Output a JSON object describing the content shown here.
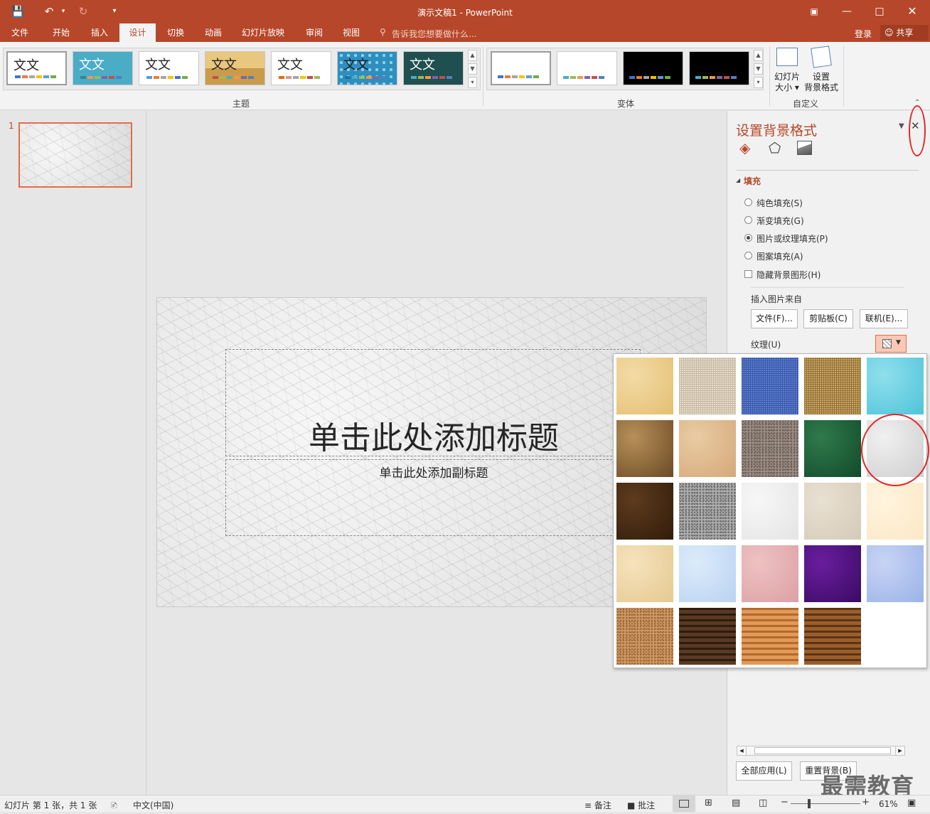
{
  "window": {
    "title": "演示文稿1 - PowerPoint"
  },
  "ribbon_tabs": [
    "文件",
    "开始",
    "插入",
    "设计",
    "切换",
    "动画",
    "幻灯片放映",
    "审阅",
    "视图"
  ],
  "active_tab": "设计",
  "tell_me": "告诉我您想要做什么...",
  "account": {
    "login": "登录",
    "share": "共享"
  },
  "themes": {
    "label": "主题",
    "items": [
      {
        "text": "文文",
        "bg": "#ffffff",
        "fg": "#222222",
        "colors": [
          "#4472c4",
          "#ed7d31",
          "#a5a5a5",
          "#ffc000",
          "#5b9bd5",
          "#70ad47"
        ]
      },
      {
        "text": "文文",
        "bg": "#4bacc6",
        "fg": "#ffffff",
        "colors": [
          "#31859c",
          "#f79646",
          "#9bbb59",
          "#8064a2",
          "#c0504d",
          "#4f81bd"
        ]
      },
      {
        "text": "文文",
        "bg": "#ffffff",
        "fg": "#222222",
        "colors": [
          "#5b9bd5",
          "#ed7d31",
          "#a5a5a5",
          "#ffc000",
          "#4472c4",
          "#70ad47"
        ]
      },
      {
        "text": "文文",
        "bg": "#e9c77f",
        "fg": "#222222",
        "colors": [
          "#c0504d",
          "#9bbb59",
          "#4bacc6",
          "#f79646",
          "#8064a2",
          "#4f81bd"
        ]
      },
      {
        "text": "文文",
        "bg": "#ffffff",
        "fg": "#222222",
        "colors": [
          "#e46c0a",
          "#d99694",
          "#a5a5a5",
          "#ffc000",
          "#c0504d",
          "#9bbb59"
        ]
      },
      {
        "text": "文文",
        "bg": "#2e8fbf",
        "fg": "#222222",
        "colors": [
          "#1f6f9f",
          "#4bacc6",
          "#9bbb59",
          "#f79646",
          "#8064a2",
          "#4f81bd"
        ]
      },
      {
        "text": "文文",
        "bg": "#1f4f4f",
        "fg": "#ffffff",
        "colors": [
          "#4bacc6",
          "#9bbb59",
          "#f79646",
          "#8064a2",
          "#c0504d",
          "#4f81bd"
        ]
      }
    ]
  },
  "variants": {
    "label": "变体",
    "items": [
      {
        "bg": "#ffffff",
        "colors": [
          "#4472c4",
          "#ed7d31",
          "#a5a5a5",
          "#ffc000",
          "#5b9bd5",
          "#70ad47"
        ]
      },
      {
        "bg": "#ffffff",
        "colors": [
          "#4bacc6",
          "#9bbb59",
          "#f79646",
          "#8064a2",
          "#c0504d",
          "#4f81bd"
        ]
      },
      {
        "bg": "#000000",
        "colors": [
          "#4472c4",
          "#ed7d31",
          "#a5a5a5",
          "#ffc000",
          "#5b9bd5",
          "#70ad47"
        ]
      },
      {
        "bg": "#000000",
        "colors": [
          "#4bacc6",
          "#9bbb59",
          "#f79646",
          "#8064a2",
          "#c0504d",
          "#4f81bd"
        ]
      }
    ]
  },
  "customize": {
    "label": "自定义",
    "slide_size_l1": "幻灯片",
    "slide_size_l2": "大小",
    "format_bg_l1": "设置",
    "format_bg_l2": "背景格式"
  },
  "thumbnails": [
    {
      "num": "1"
    }
  ],
  "slide": {
    "title": "单击此处添加标题",
    "subtitle": "单击此处添加副标题"
  },
  "format_pane": {
    "title": "设置背景格式",
    "section": "填充",
    "fill_options": [
      {
        "label": "纯色填充(S)",
        "checked": false
      },
      {
        "label": "渐变填充(G)",
        "checked": false
      },
      {
        "label": "图片或纹理填充(P)",
        "checked": true
      },
      {
        "label": "图案填充(A)",
        "checked": false
      }
    ],
    "hide_bg": "隐藏背景图形(H)",
    "insert_from": "插入图片来自",
    "btn_file": "文件(F)...",
    "btn_clipboard": "剪贴板(C)",
    "btn_online": "联机(E)...",
    "texture_label": "纹理(U)",
    "apply_all": "全部应用(L)",
    "reset": "重置背景(B)"
  },
  "textures": [
    {
      "c1": "#f3dba6",
      "c2": "#e4bf72",
      "kind": "papyrus"
    },
    {
      "c1": "#e6dccb",
      "c2": "#c8baa2",
      "kind": "canvas"
    },
    {
      "c1": "#5c7ed0",
      "c2": "#3a58a8",
      "kind": "denim"
    },
    {
      "c1": "#c8a467",
      "c2": "#957236",
      "kind": "woven"
    },
    {
      "c1": "#8fe0ec",
      "c2": "#4fc3da",
      "kind": "water"
    },
    {
      "c1": "#b79058",
      "c2": "#6b4a25",
      "kind": "paper-bag"
    },
    {
      "c1": "#e9cba3",
      "c2": "#d4a97a",
      "kind": "fish-fossil"
    },
    {
      "c1": "#9c8e84",
      "c2": "#6e625a",
      "kind": "sand"
    },
    {
      "c1": "#2f7a4c",
      "c2": "#124a2a",
      "kind": "green-marble"
    },
    {
      "c1": "#f0f0f0",
      "c2": "#cfcfcf",
      "kind": "white-marble"
    },
    {
      "c1": "#5e3b1d",
      "c2": "#311c0b",
      "kind": "brown-marble"
    },
    {
      "c1": "#b0b0b0",
      "c2": "#707070",
      "kind": "granite"
    },
    {
      "c1": "#f7f7f7",
      "c2": "#e4e4e4",
      "kind": "newsprint"
    },
    {
      "c1": "#e8e0d2",
      "c2": "#d5cab7",
      "kind": "recycled-paper"
    },
    {
      "c1": "#fff4de",
      "c2": "#fbe8c5",
      "kind": "parchment"
    },
    {
      "c1": "#f6e3bd",
      "c2": "#e4c990",
      "kind": "stationery"
    },
    {
      "c1": "#dcebfb",
      "c2": "#b9d3f1",
      "kind": "blue-tissue"
    },
    {
      "c1": "#eec2c2",
      "c2": "#dca0a5",
      "kind": "pink-tissue"
    },
    {
      "c1": "#6a1d9e",
      "c2": "#3a0b63",
      "kind": "purple-mesh"
    },
    {
      "c1": "#c8d4f4",
      "c2": "#9ab3e8",
      "kind": "bouquet"
    },
    {
      "c1": "#d09a66",
      "c2": "#a06b3a",
      "kind": "cork"
    },
    {
      "c1": "#5a3a23",
      "c2": "#2e1c10",
      "kind": "walnut"
    },
    {
      "c1": "#e19a57",
      "c2": "#b36a2c",
      "kind": "oak"
    },
    {
      "c1": "#9b5e2b",
      "c2": "#5b3414",
      "kind": "medium-wood"
    }
  ],
  "status": {
    "slide_info": "幻灯片 第 1 张，共 1 张",
    "language": "中文(中国)",
    "notes": "备注",
    "comments": "批注",
    "zoom": "61%"
  },
  "watermark": "最需教育",
  "colors": {
    "accent": "#b7472a",
    "annotation": "#e0272a"
  }
}
